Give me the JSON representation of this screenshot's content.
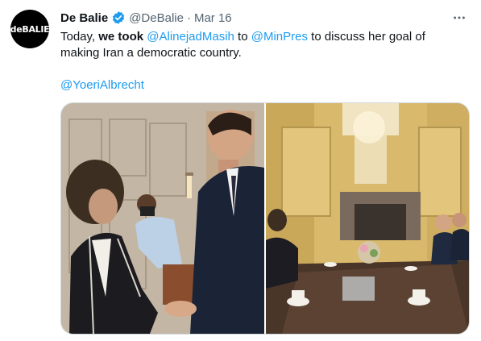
{
  "account": {
    "avatar_text": "deBALIE",
    "name": "De Balie",
    "handle": "@DeBalie",
    "separator": "·",
    "date": "Mar 16",
    "verified_icon": "verified-badge-icon"
  },
  "tweet": {
    "text_before": "Today, ",
    "text_bold": "we took",
    "text_space": " ",
    "mention_1": "@AlinejadMasih",
    "text_to": " to ",
    "mention_2": "@MinPres",
    "text_after": " to discuss her goal of making Iran a democratic country.",
    "mention_3": "@YoeriAlbrecht"
  },
  "more_icon": "more-horizontal-icon",
  "colors": {
    "link": "#1d9bf0",
    "text": "#0f1419",
    "secondary": "#536471",
    "verified": "#1d9bf0"
  }
}
